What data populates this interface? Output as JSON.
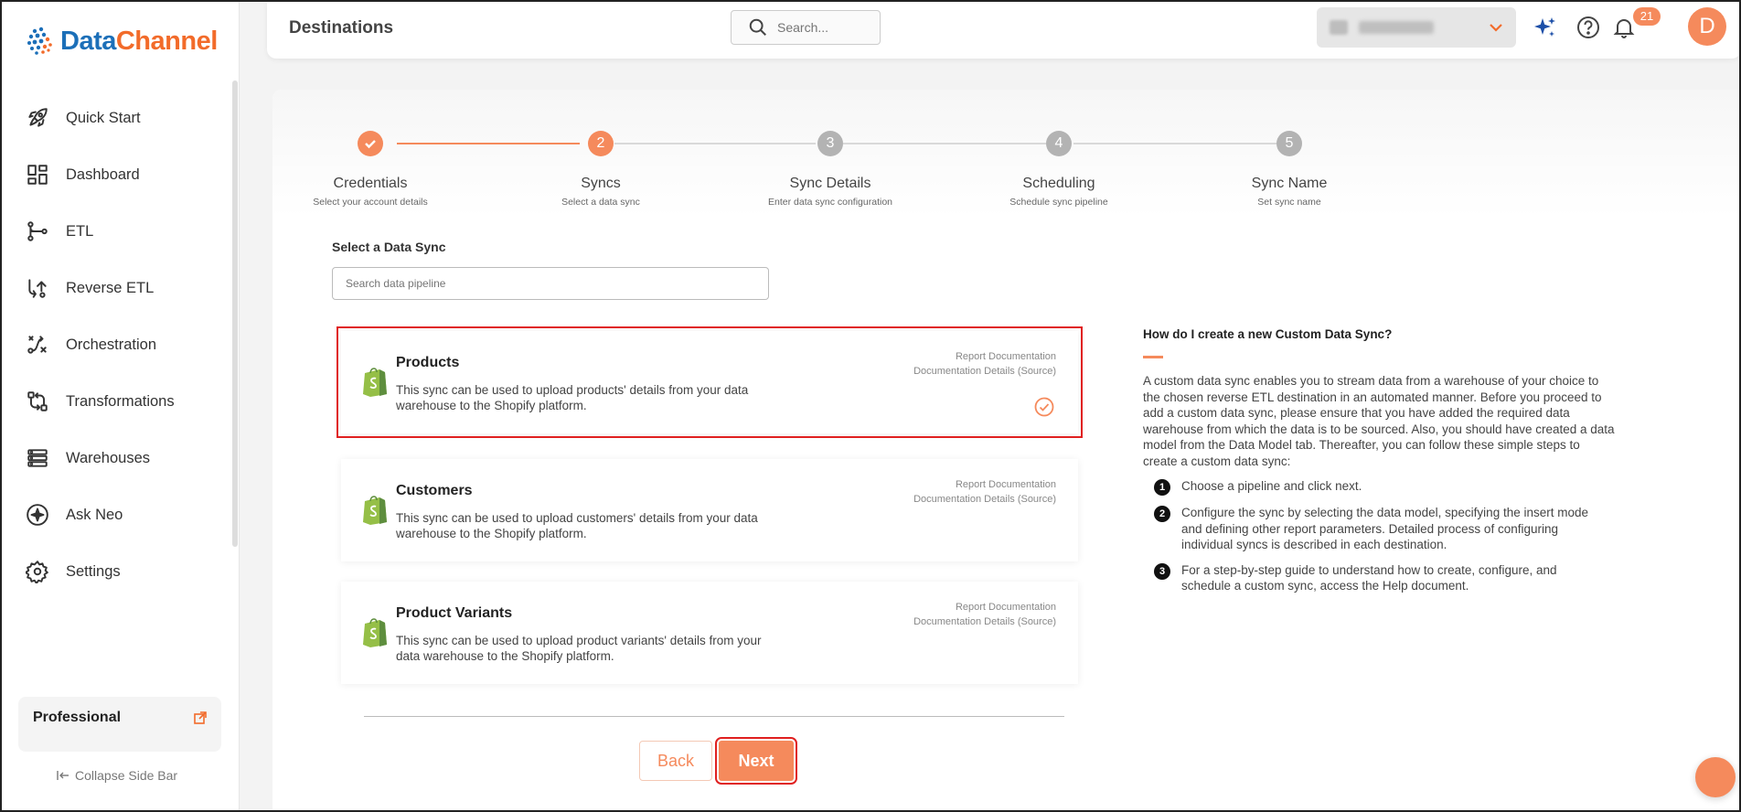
{
  "brand": {
    "name_part1": "Data",
    "name_part2": "Channel",
    "color_primary": "#1c6fb8",
    "color_accent": "#f26b2a"
  },
  "sidebar": {
    "items": [
      {
        "label": "Quick Start",
        "icon": "rocket-icon"
      },
      {
        "label": "Dashboard",
        "icon": "dashboard-icon"
      },
      {
        "label": "ETL",
        "icon": "etl-icon"
      },
      {
        "label": "Reverse ETL",
        "icon": "reverse-etl-icon"
      },
      {
        "label": "Orchestration",
        "icon": "orchestration-icon"
      },
      {
        "label": "Transformations",
        "icon": "transformations-icon"
      },
      {
        "label": "Warehouses",
        "icon": "warehouses-icon"
      },
      {
        "label": "Ask Neo",
        "icon": "sparkle-icon"
      },
      {
        "label": "Settings",
        "icon": "gear-icon"
      }
    ],
    "plan_label": "Professional",
    "collapse_label": "Collapse Side Bar"
  },
  "header": {
    "title": "Destinations",
    "search_placeholder": "Search...",
    "notification_count": "21",
    "avatar_initial": "D"
  },
  "stepper": {
    "steps": [
      {
        "number": "",
        "title": "Credentials",
        "subtitle": "Select your account details",
        "state": "done"
      },
      {
        "number": "2",
        "title": "Syncs",
        "subtitle": "Select a data sync",
        "state": "active"
      },
      {
        "number": "3",
        "title": "Sync Details",
        "subtitle": "Enter data sync configuration",
        "state": "pending"
      },
      {
        "number": "4",
        "title": "Scheduling",
        "subtitle": "Schedule sync pipeline",
        "state": "pending"
      },
      {
        "number": "5",
        "title": "Sync Name",
        "subtitle": "Set sync name",
        "state": "pending"
      }
    ]
  },
  "sync_select": {
    "label": "Select a Data Sync",
    "search_placeholder": "Search data pipeline"
  },
  "syncs": [
    {
      "title": "Products",
      "description": "This sync can be used to upload products' details from your data warehouse to the Shopify platform.",
      "doc_link1": "Report Documentation",
      "doc_link2": "Documentation Details (Source)",
      "selected": true
    },
    {
      "title": "Customers",
      "description": "This sync can be used to upload customers' details from your data warehouse to the Shopify platform.",
      "doc_link1": "Report Documentation",
      "doc_link2": "Documentation Details (Source)",
      "selected": false
    },
    {
      "title": "Product Variants",
      "description": "This sync can be used to upload product variants' details from your data warehouse to the Shopify platform.",
      "doc_link1": "Report Documentation",
      "doc_link2": "Documentation Details (Source)",
      "selected": false
    }
  ],
  "buttons": {
    "back": "Back",
    "next": "Next"
  },
  "help": {
    "title": "How do I create a new Custom Data Sync?",
    "paragraph": "A custom data sync enables you to stream data from a warehouse of your choice to the chosen reverse ETL destination in an automated manner. Before you proceed to add a custom data sync, please ensure that you have added the required data warehouse from which the data is to be sourced. Also, you should have created a data model from the Data Model tab. Thereafter, you can follow these simple steps to create a custom data sync:",
    "steps": [
      {
        "num": "1",
        "text": "Choose a pipeline and click next."
      },
      {
        "num": "2",
        "text": "Configure the sync by selecting the data model, specifying the insert mode and defining other report parameters. Detailed process of configuring individual syncs is described in each destination."
      },
      {
        "num": "3",
        "text": "For a step-by-step guide to understand how to create, configure, and schedule a custom sync, access the Help document."
      }
    ]
  }
}
